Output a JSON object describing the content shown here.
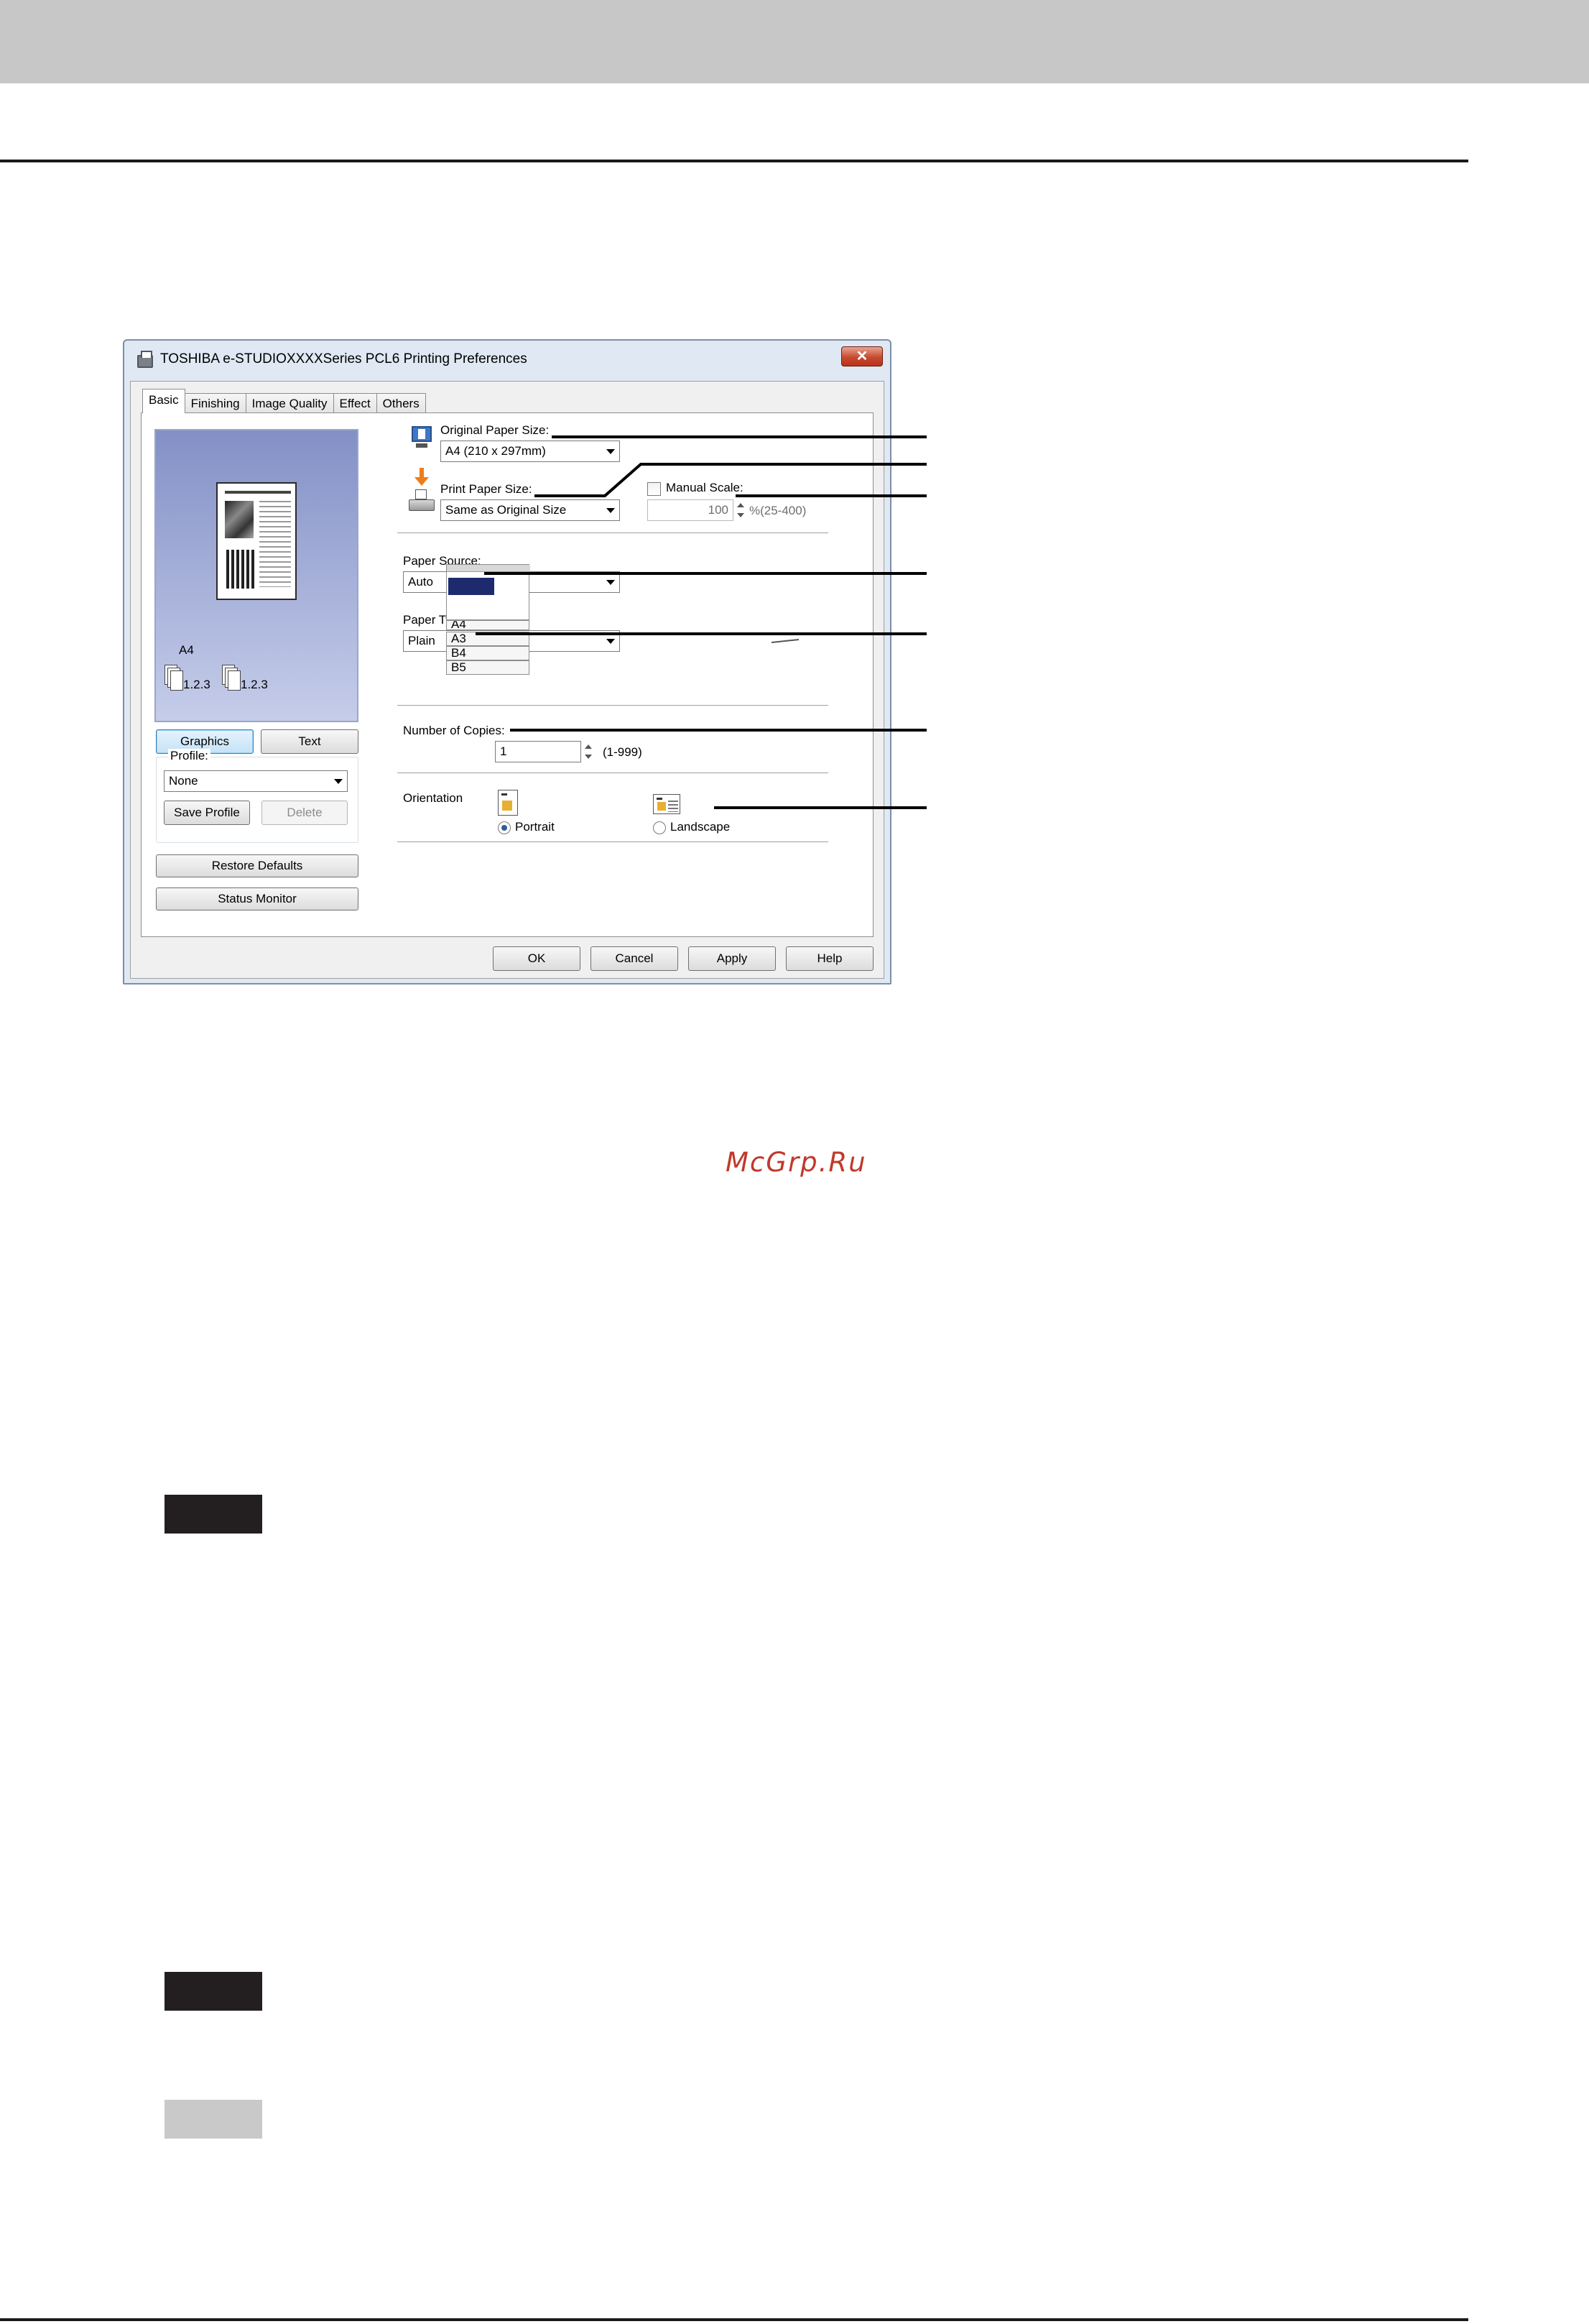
{
  "watermark": "McGrp.Ru",
  "window": {
    "title": "TOSHIBA e-STUDIOXXXXSeries PCL6 Printing Preferences",
    "close_symbol": "✕"
  },
  "tabs": [
    "Basic",
    "Finishing",
    "Image Quality",
    "Effect",
    "Others"
  ],
  "active_tab": "Basic",
  "preview": {
    "paper_size": "A4",
    "copy_order_1": "1.2.3",
    "copy_order_2": "1.2.3"
  },
  "view_buttons": {
    "graphics": "Graphics",
    "text": "Text",
    "selected": "Graphics"
  },
  "profile": {
    "group_label": "Profile:",
    "value": "None",
    "save": "Save Profile",
    "delete": "Delete"
  },
  "restore_defaults": "Restore Defaults",
  "status_monitor": "Status Monitor",
  "original_paper_size": {
    "label": "Original Paper Size:",
    "value": "A4 (210 x 297mm)"
  },
  "print_paper_size": {
    "label": "Print Paper Size:",
    "value": "Same as Original Size"
  },
  "manual_scale": {
    "label": "Manual Scale:",
    "checked": false,
    "value": "100",
    "range": "%(25-400)"
  },
  "paper_source": {
    "label": "Paper Source:",
    "value": "Auto"
  },
  "paper_type": {
    "label": "Paper Type:",
    "value": "Plain"
  },
  "trays": [
    "A4",
    "A3",
    "B4",
    "B5"
  ],
  "copies": {
    "label": "Number of Copies:",
    "value": "1",
    "range": "(1-999)"
  },
  "orientation": {
    "label": "Orientation",
    "portrait": "Portrait",
    "landscape": "Landscape",
    "selected": "Portrait"
  },
  "footer_buttons": {
    "ok": "OK",
    "cancel": "Cancel",
    "apply": "Apply",
    "help": "Help"
  },
  "colors": {
    "top_band": "#c7c7c7",
    "dark_tag": "#231f20",
    "light_tag": "#c9c9c9",
    "watermark": "#c0392b",
    "close_button": "#c74a2f",
    "preview_bg": "#8390c6"
  },
  "icons": [
    "printer-icon",
    "close-icon",
    "monitor-icon",
    "down-arrow-icon",
    "printer-paper-icon",
    "machine-icon",
    "portrait-icon",
    "landscape-icon"
  ]
}
